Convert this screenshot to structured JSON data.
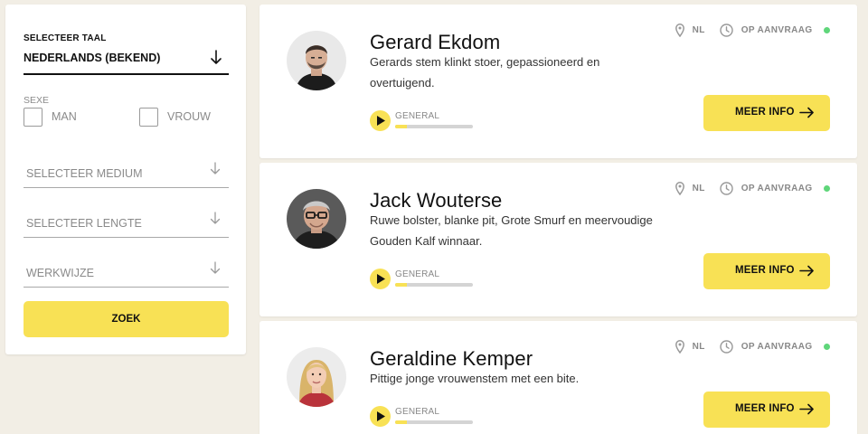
{
  "filters": {
    "language_label": "SELECTEER TAAL",
    "language_value": "NEDERLANDS (BEKEND)",
    "sexe_label": "SEXE",
    "options": [
      {
        "label": "MAN",
        "checked": false
      },
      {
        "label": "VROUW",
        "checked": false
      }
    ],
    "medium_placeholder": "SELECTEER MEDIUM",
    "length_placeholder": "SELECTEER LENGTE",
    "method_placeholder": "WERKWIJZE",
    "search_label": "ZOEK"
  },
  "artists": [
    {
      "name": "Gerard Ekdom",
      "description": "Gerards stem klinkt stoer, gepassioneerd en overtuigend.",
      "genre": "GENERAL",
      "progress": 0.15,
      "country": "NL",
      "availability": "OP AANVRAAG",
      "more_label": "MEER INFO"
    },
    {
      "name": "Jack Wouterse",
      "description": "Ruwe bolster, blanke pit, Grote Smurf en meervoudige Gouden Kalf winnaar.",
      "genre": "GENERAL",
      "progress": 0.15,
      "country": "NL",
      "availability": "OP AANVRAAG",
      "more_label": "MEER INFO"
    },
    {
      "name": "Geraldine Kemper",
      "description": "Pittige jonge vrouwenstem met een bite.",
      "genre": "GENERAL",
      "progress": 0.15,
      "country": "NL",
      "availability": "OP AANVRAAG",
      "more_label": "MEER INFO"
    }
  ],
  "colors": {
    "accent": "#f8e155",
    "background": "#f2eee5",
    "status_available": "#5fd67a"
  },
  "icons": {
    "language_arrow": "arrow-down-icon",
    "select_arrow": "chevron-down-icon",
    "location": "map-pin-icon",
    "availability": "clock-icon",
    "play": "play-icon",
    "more": "arrow-right-icon"
  }
}
